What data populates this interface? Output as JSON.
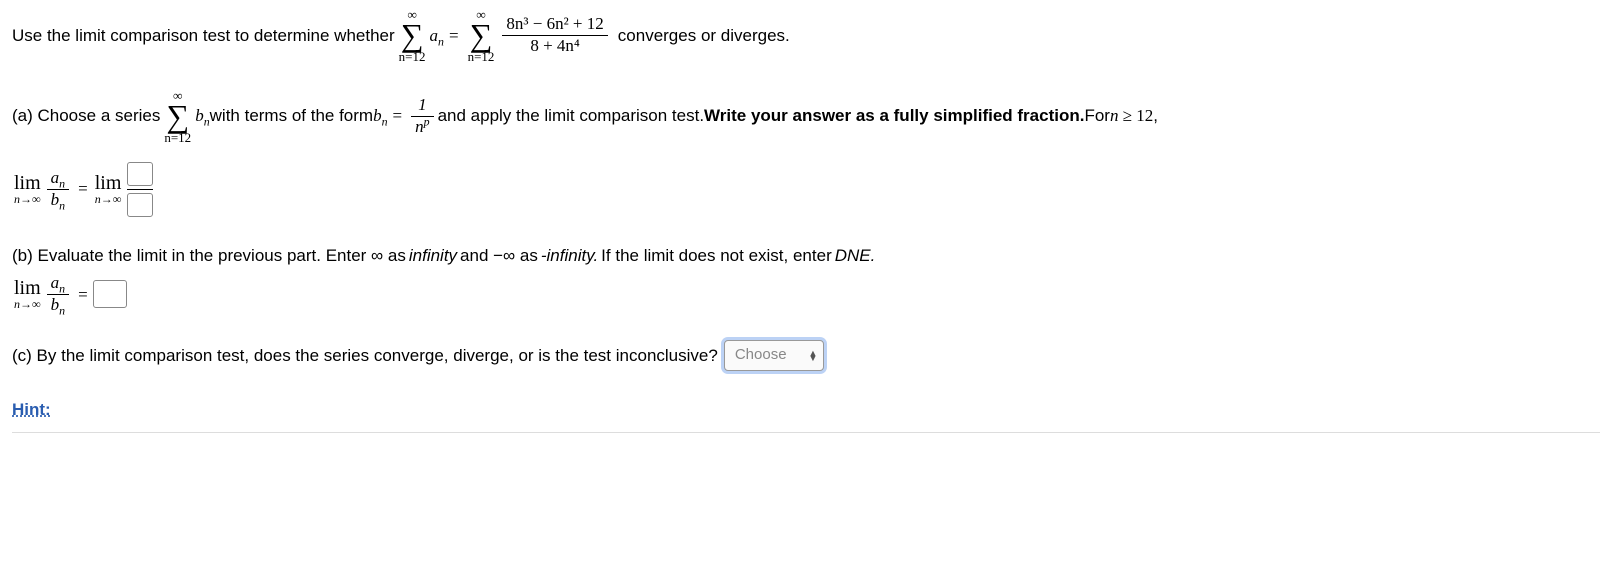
{
  "intro": {
    "pre": "Use the limit comparison test to determine whether",
    "sum_top": "∞",
    "sum_bot": "n=12",
    "an": "a",
    "an_sub": "n",
    "eq": "=",
    "numer": "8n³ − 6n² + 12",
    "denom": "8 + 4n⁴",
    "post": "converges or diverges."
  },
  "partA": {
    "label": "(a) Choose a series",
    "sum_top": "∞",
    "sum_bot": "n=12",
    "bn": "b",
    "bn_sub": "n",
    "mid1": " with terms of the form ",
    "bn2": "b",
    "bn2_sub": "n",
    "eq": "=",
    "fr_num": "1",
    "fr_den_base": "n",
    "fr_den_exp": "p",
    "mid2": " and apply the limit comparison test. ",
    "bold": "Write your answer as a fully simplified fraction.",
    "tail": " For ",
    "cond_var": "n",
    "cond_op": " ≥ ",
    "cond_val": "12",
    "comma": ","
  },
  "limitLine": {
    "lim": "lim",
    "sub": "n→∞",
    "fr_num_base": "a",
    "fr_num_sub": "n",
    "fr_den_base": "b",
    "fr_den_sub": "n",
    "eq": "=",
    "lim2": "lim",
    "sub2": "n→∞"
  },
  "partB": {
    "text": "(b) Evaluate the limit in the previous part. Enter ∞ as ",
    "inf_word": "infinity",
    "text2": " and −∞ as ",
    "ninf_word": "-infinity.",
    "text3": " If the limit does not exist, enter ",
    "dne": "DNE.",
    "lim": "lim",
    "sub": "n→∞",
    "fr_num_base": "a",
    "fr_num_sub": "n",
    "fr_den_base": "b",
    "fr_den_sub": "n",
    "eq": "="
  },
  "partC": {
    "text": "(c) By the limit comparison test, does the series converge, diverge, or is the test inconclusive?",
    "placeholder": "Choose"
  },
  "hint": "Hint:"
}
